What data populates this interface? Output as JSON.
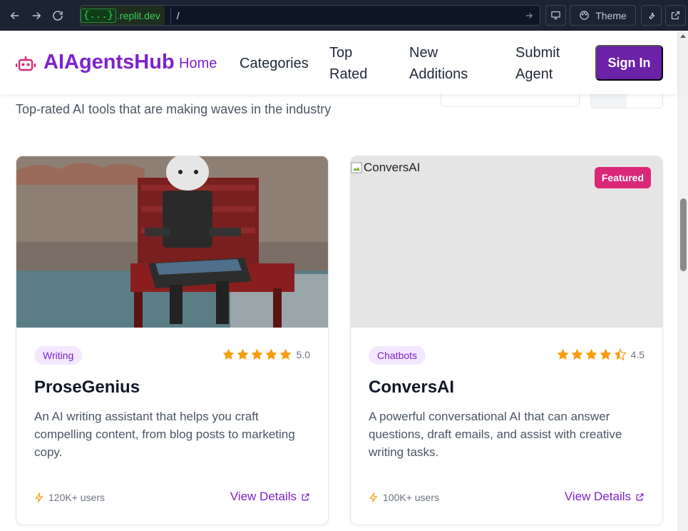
{
  "browser": {
    "url_badge": "{...}",
    "url_domain": ".replit.dev",
    "url_path": "/",
    "theme_label": "Theme"
  },
  "header": {
    "logo": "AIAgentsHub",
    "nav": [
      {
        "label": "Home"
      },
      {
        "label": "Categories"
      },
      {
        "label": "Top Rated"
      },
      {
        "label": "New Additions"
      },
      {
        "label": "Submit Agent"
      }
    ],
    "signin": "Sign In"
  },
  "main": {
    "subtitle": "Top-rated AI tools that are making waves in the industry"
  },
  "cards": [
    {
      "image_alt": "",
      "category": "Writing",
      "rating": 5,
      "rating_label": "5.0",
      "title": "ProseGenius",
      "description": "An AI writing assistant that helps you craft compelling content, from blog posts to marketing copy.",
      "users": "120K+ users",
      "details_label": "View Details",
      "featured": false
    },
    {
      "image_alt": "ConversAI",
      "category": "Chatbots",
      "rating": 4.5,
      "rating_label": "4.5",
      "title": "ConversAI",
      "description": "A powerful conversational AI that can answer questions, draft emails, and assist with creative writing tasks.",
      "users": "100K+ users",
      "details_label": "View Details",
      "featured": true,
      "featured_label": "Featured"
    }
  ],
  "colors": {
    "brand": "#7e22ce",
    "accent": "#db2777",
    "star": "#f59e0b",
    "chrome_bg": "#1c2333"
  }
}
